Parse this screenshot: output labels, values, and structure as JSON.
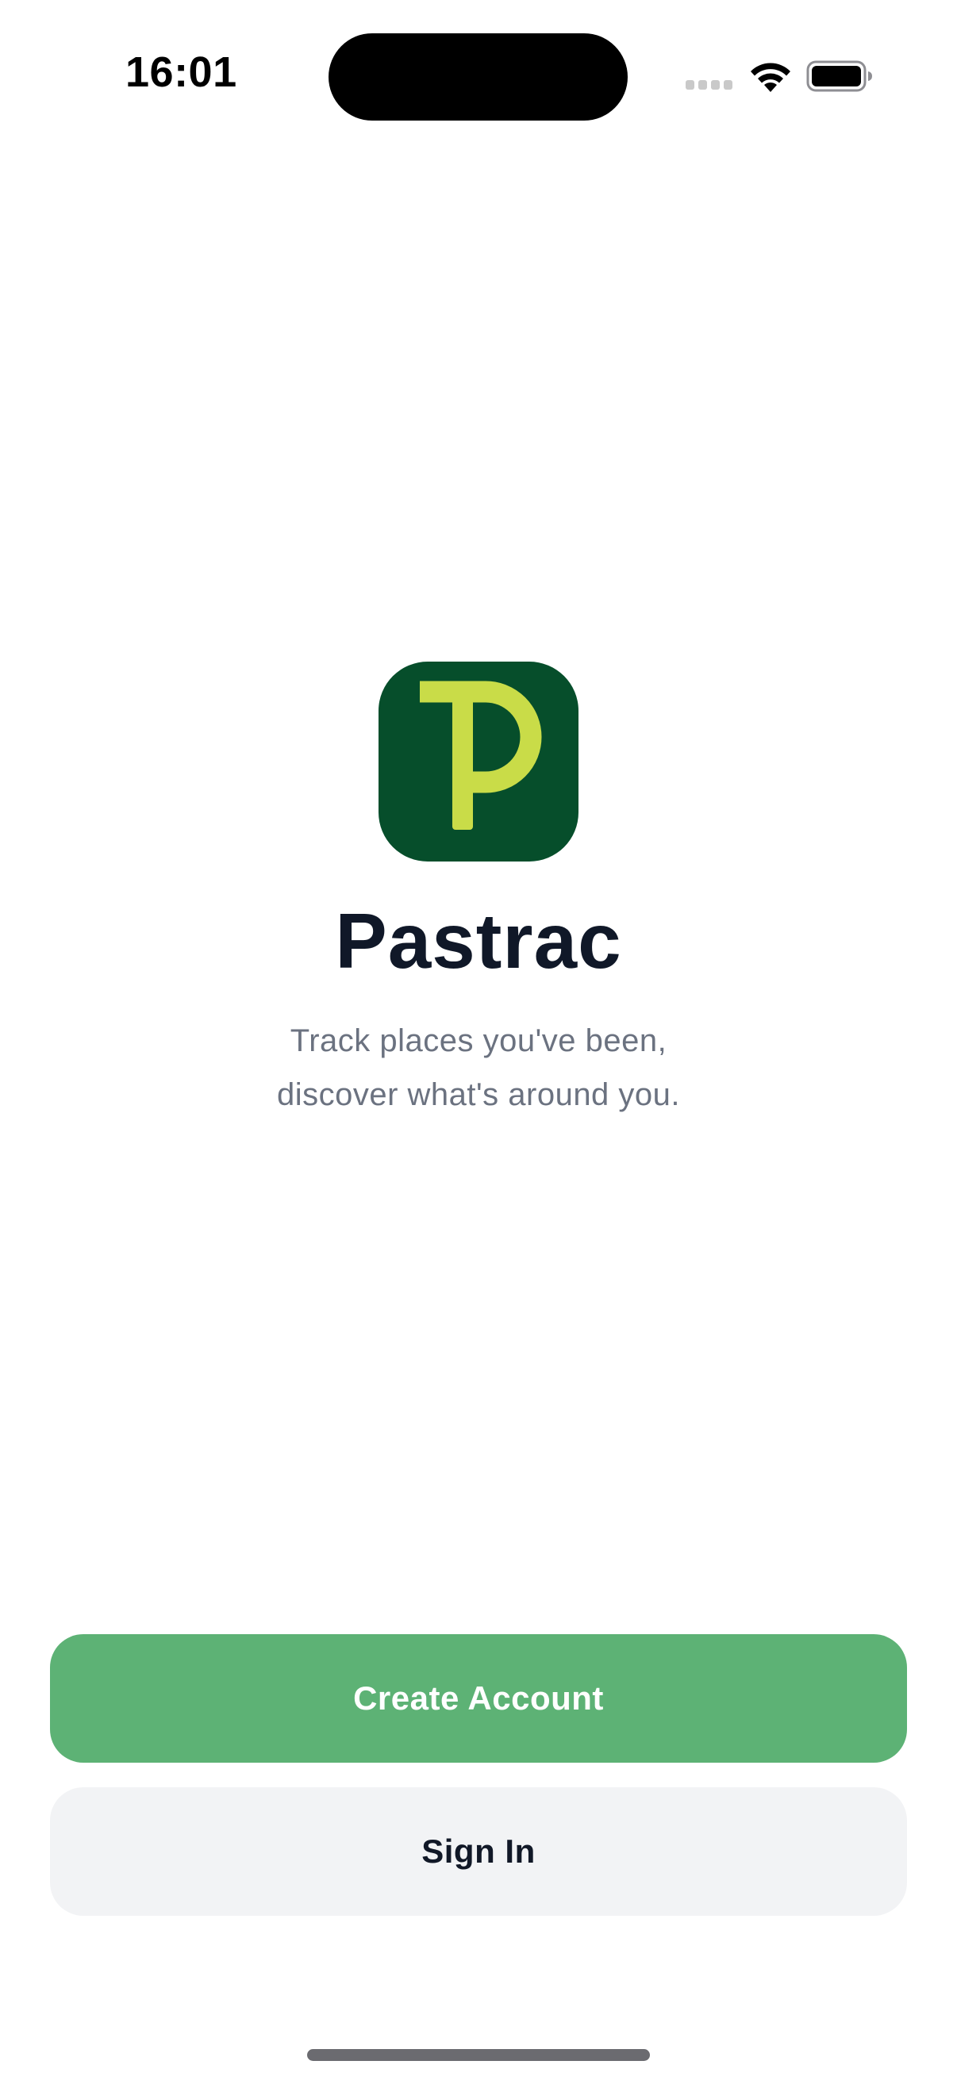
{
  "status_bar": {
    "time": "16:01",
    "icons": [
      "cellular-signal-icon",
      "wifi-icon",
      "battery-icon"
    ]
  },
  "app": {
    "logo_icon": "pastrac-logo-icon",
    "logo_background_color": "#064e2b",
    "logo_accent_color": "#c9dc48",
    "title": "Pastrac",
    "tagline_line1": "Track places you've been,",
    "tagline_line2": "discover what's around you."
  },
  "actions": {
    "create_account_label": "Create Account",
    "create_account_color": "#5db275",
    "sign_in_label": "Sign In",
    "sign_in_color": "#f2f3f5"
  }
}
